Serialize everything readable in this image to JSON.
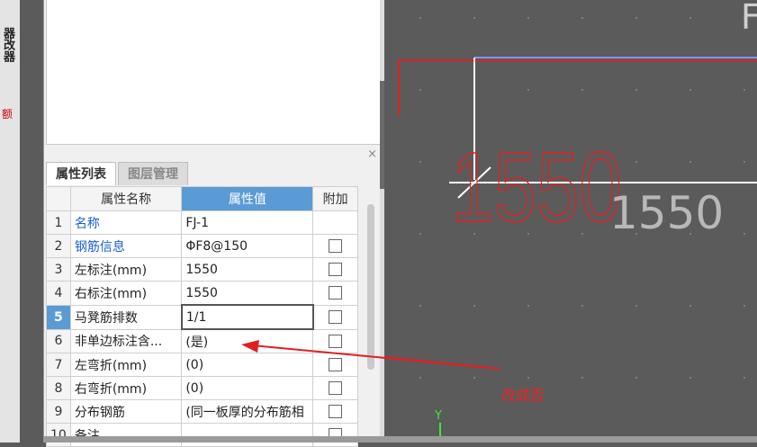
{
  "left_strip": {
    "text1": "器改器",
    "text2": "额"
  },
  "tabs": [
    {
      "label": "属性列表",
      "active": true
    },
    {
      "label": "图层管理",
      "active": false
    }
  ],
  "close_glyph": "×",
  "table": {
    "headers": {
      "name": "属性名称",
      "value": "属性值",
      "extra": "附加"
    },
    "rows": [
      {
        "num": "1",
        "name": "名称",
        "value": "FJ-1",
        "blue": true,
        "checkbox": false
      },
      {
        "num": "2",
        "name": "钢筋信息",
        "value": "ΦF8@150",
        "blue": true,
        "checkbox": true
      },
      {
        "num": "3",
        "name": "左标注(mm)",
        "value": "1550",
        "blue": false,
        "checkbox": true
      },
      {
        "num": "4",
        "name": "右标注(mm)",
        "value": "1550",
        "blue": false,
        "checkbox": true
      },
      {
        "num": "5",
        "name": "马凳筋排数",
        "value": "1/1",
        "blue": false,
        "checkbox": true,
        "selected": true
      },
      {
        "num": "6",
        "name": "非单边标注含...",
        "value": "(是)",
        "blue": false,
        "checkbox": true
      },
      {
        "num": "7",
        "name": "左弯折(mm)",
        "value": "(0)",
        "blue": false,
        "checkbox": true
      },
      {
        "num": "8",
        "name": "右弯折(mm)",
        "value": "(0)",
        "blue": false,
        "checkbox": true
      },
      {
        "num": "9",
        "name": "分布钢筋",
        "value": "(同一板厚的分布筋相",
        "blue": false,
        "checkbox": true
      },
      {
        "num": "10",
        "name": "备注",
        "value": "",
        "blue": false,
        "checkbox": true
      }
    ]
  },
  "cad": {
    "big_red_text": "1550",
    "gray_text": "1550",
    "corner_text": "F",
    "axis_y": "Y"
  },
  "annotation": {
    "text": "改成否",
    "color": "#ee2222"
  },
  "colors": {
    "accent": "#5b9bd5",
    "link": "#1a5fd6",
    "cad_bg": "#5b5b5b"
  }
}
